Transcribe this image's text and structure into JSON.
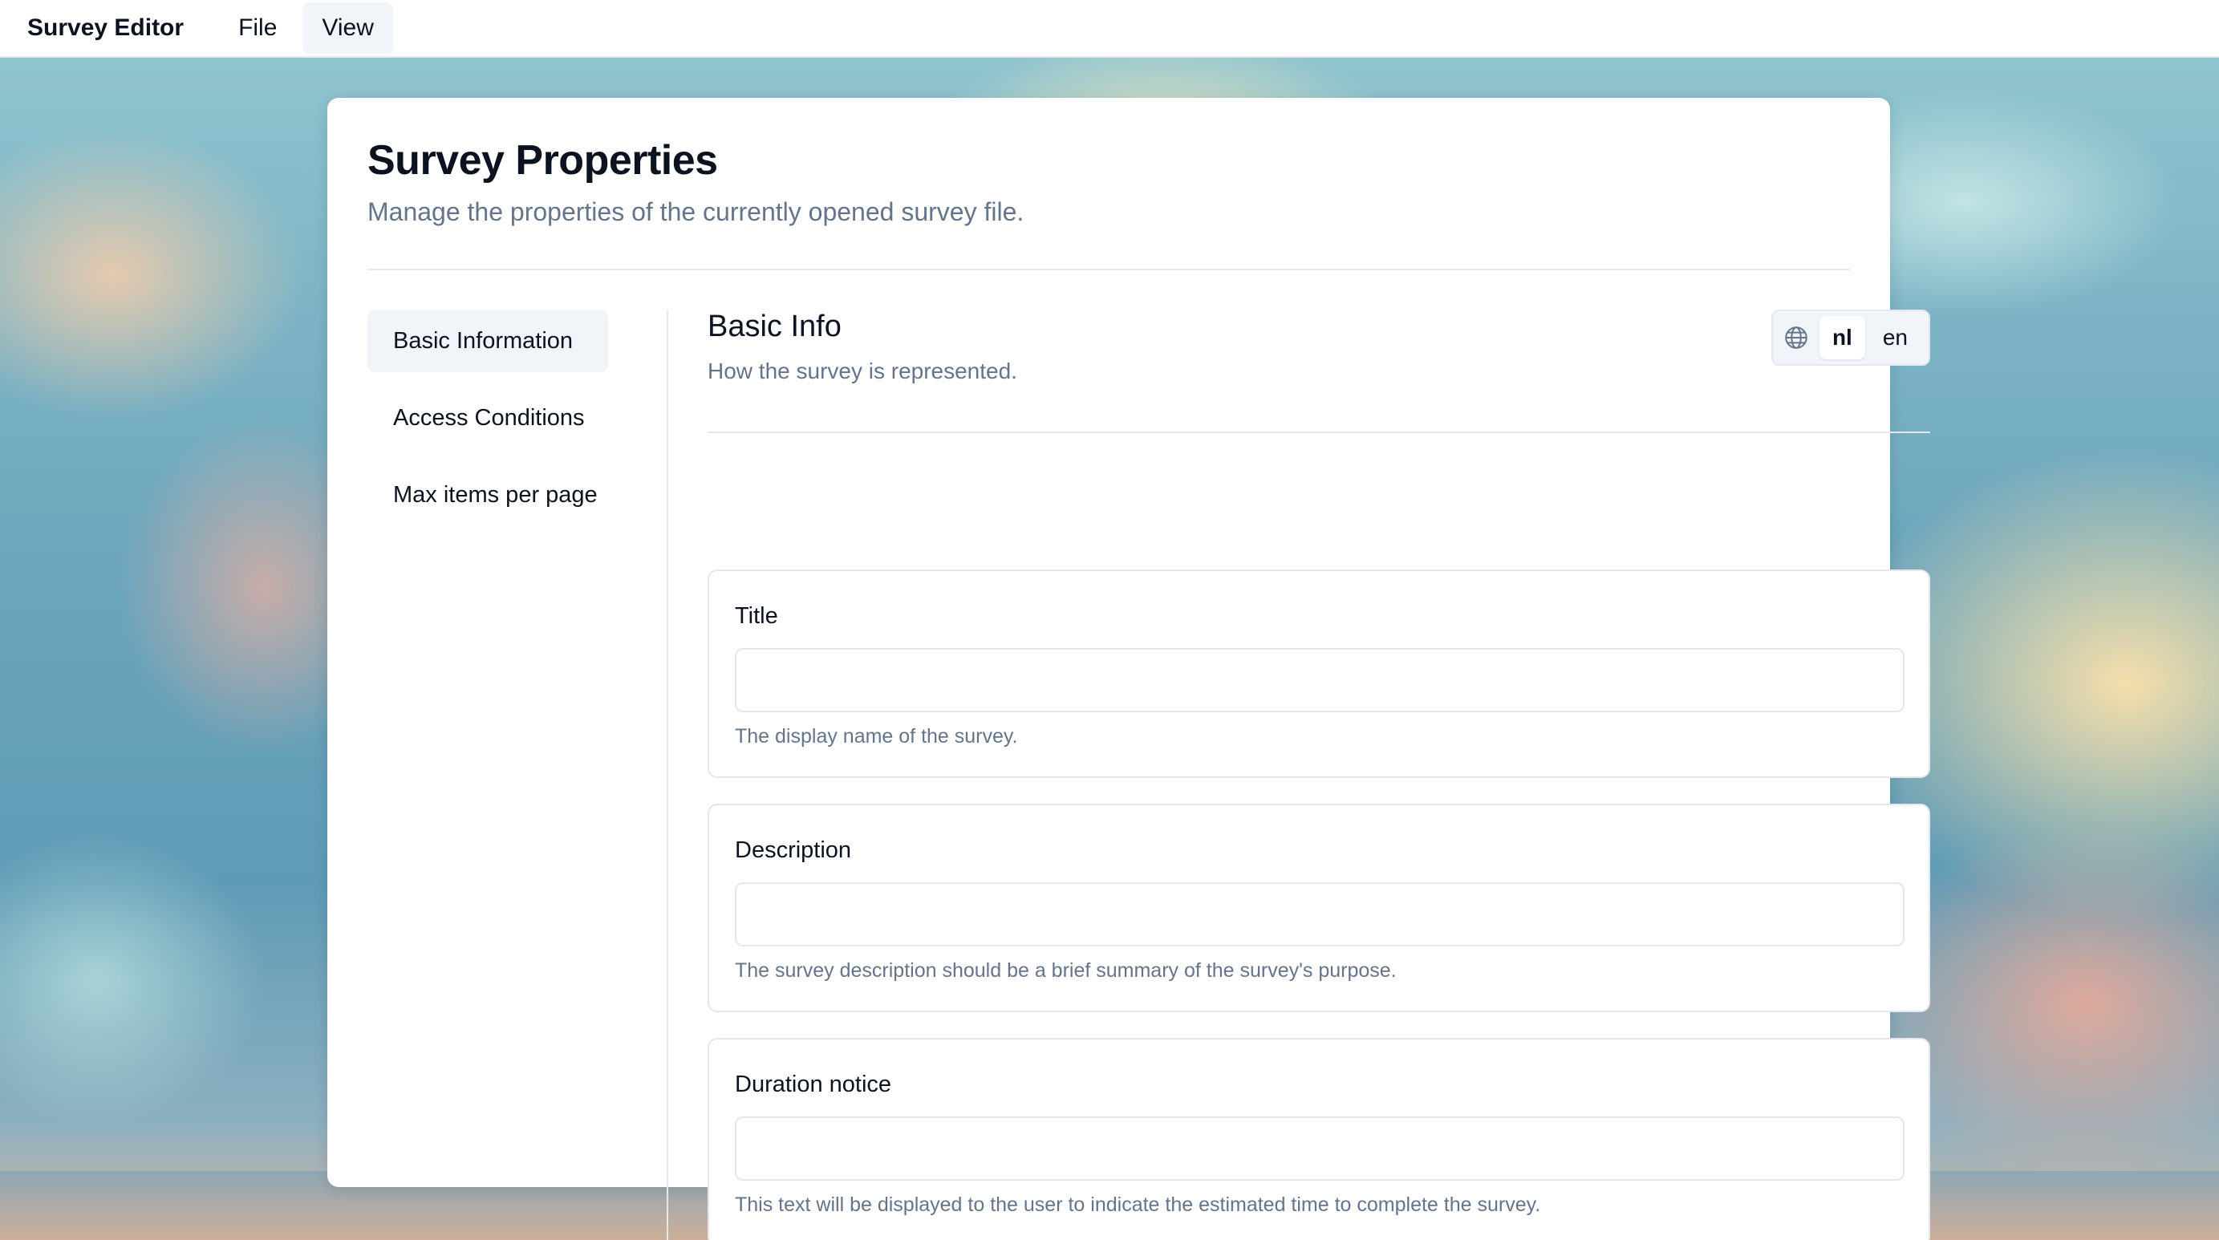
{
  "menubar": {
    "app_title": "Survey Editor",
    "items": [
      {
        "label": "File",
        "active": false
      },
      {
        "label": "View",
        "active": true
      }
    ]
  },
  "page": {
    "title": "Survey Properties",
    "subtitle": "Manage the properties of the currently opened survey file."
  },
  "sidebar": {
    "items": [
      {
        "label": "Basic Information",
        "active": true
      },
      {
        "label": "Access Conditions",
        "active": false
      },
      {
        "label": "Max items per page",
        "active": false
      }
    ]
  },
  "section": {
    "title": "Basic Info",
    "subtitle": "How the survey is represented."
  },
  "language_switch": {
    "icon": "globe-icon",
    "options": [
      {
        "label": "nl",
        "active": true
      },
      {
        "label": "en",
        "active": false
      }
    ]
  },
  "fields": [
    {
      "label": "Title",
      "value": "",
      "placeholder": "",
      "help": "The display name of the survey."
    },
    {
      "label": "Description",
      "value": "",
      "placeholder": "",
      "help": "The survey description should be a brief summary of the survey's purpose."
    },
    {
      "label": "Duration notice",
      "value": "",
      "placeholder": "",
      "help": "This text will be displayed to the user to indicate the estimated time to complete the survey."
    }
  ],
  "colors": {
    "text_primary": "#0b1220",
    "text_muted": "#64748b",
    "border": "#e5e7eb",
    "active_bg": "#f1f5f9"
  }
}
